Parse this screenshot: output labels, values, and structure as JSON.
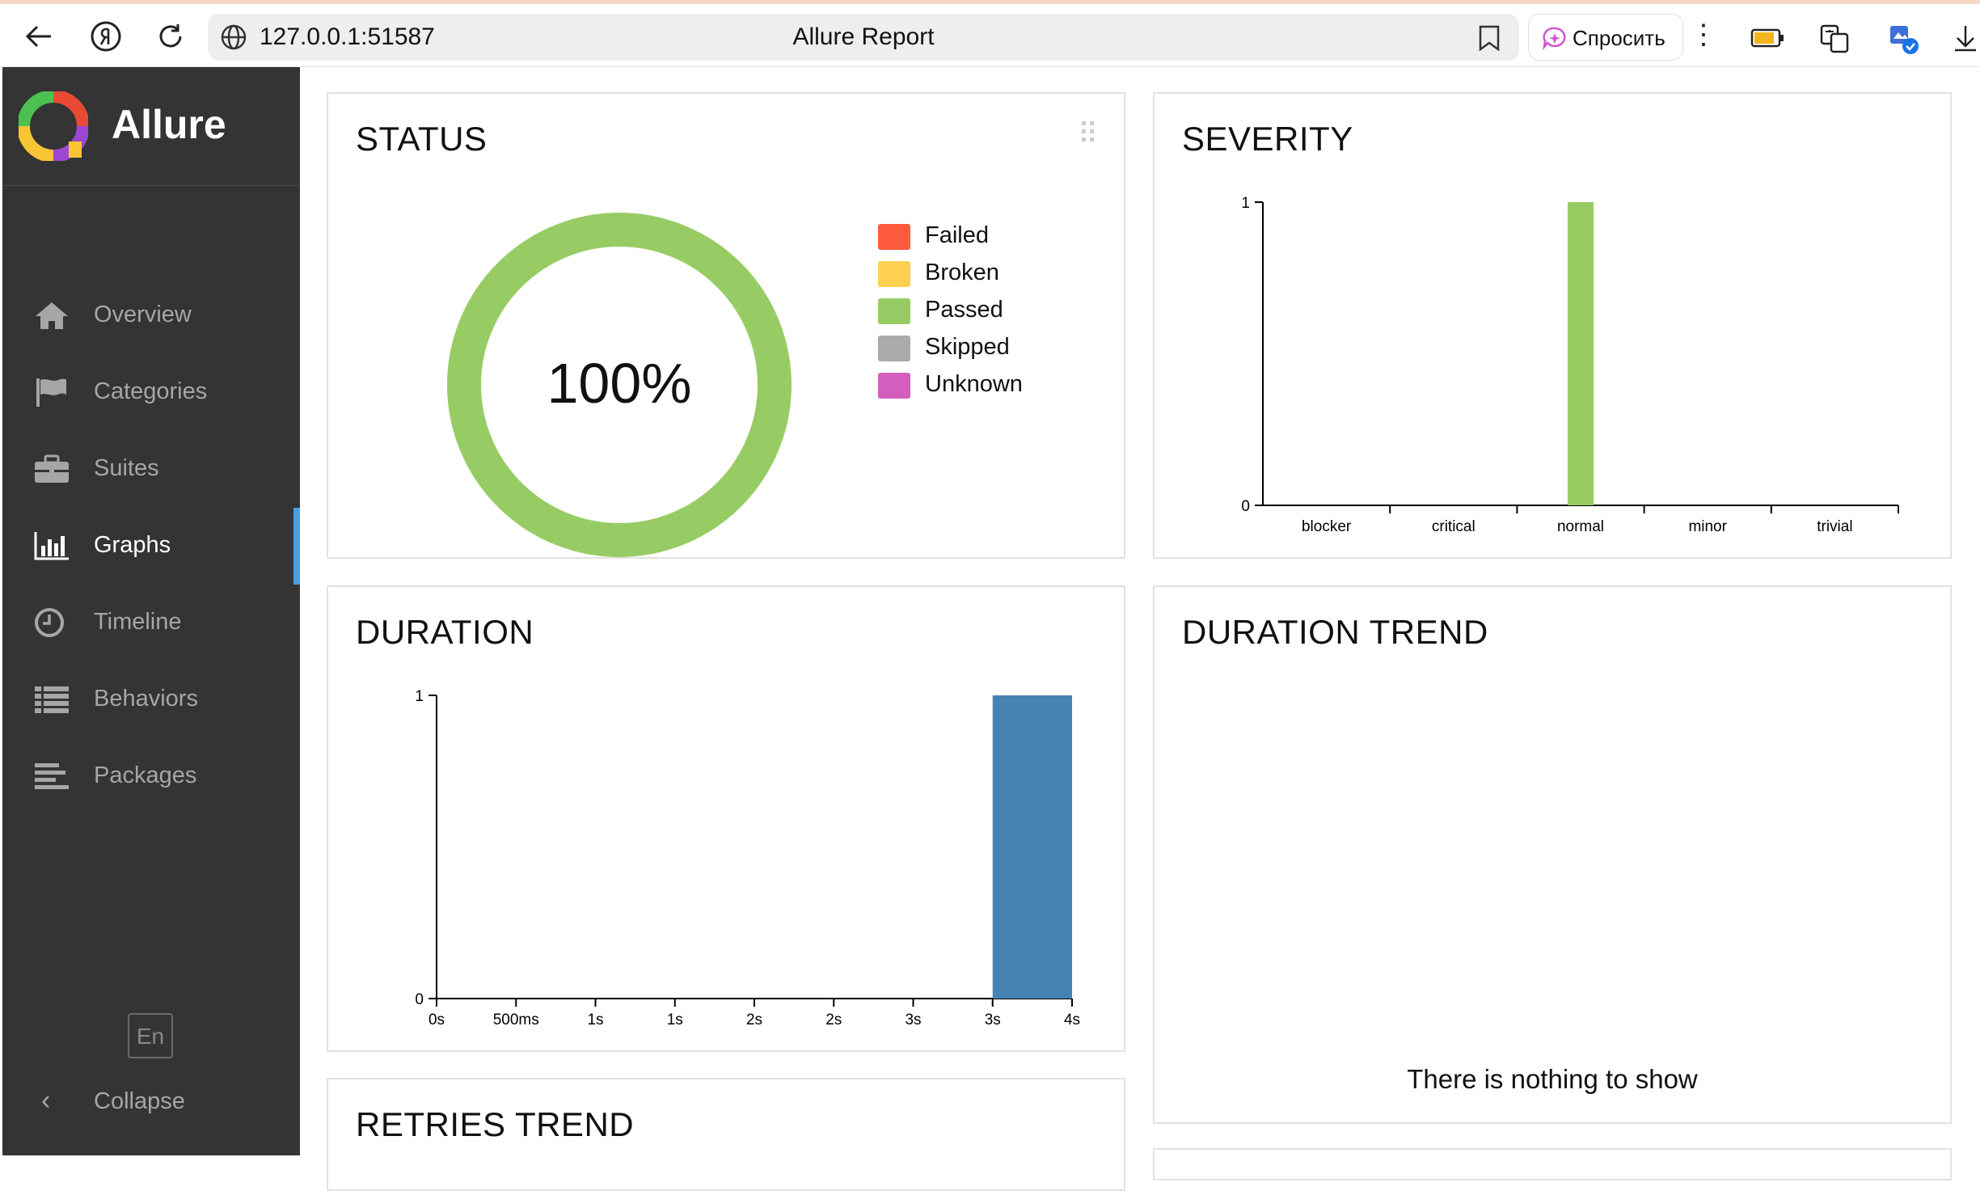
{
  "browser": {
    "url": "127.0.0.1:51587",
    "page_title": "Allure Report",
    "ask_label": "Спросить"
  },
  "sidebar": {
    "brand": "Allure",
    "items": [
      {
        "label": "Overview",
        "icon": "home-icon",
        "active": false
      },
      {
        "label": "Categories",
        "icon": "flag-icon",
        "active": false
      },
      {
        "label": "Suites",
        "icon": "briefcase-icon",
        "active": false
      },
      {
        "label": "Graphs",
        "icon": "bar-chart-icon",
        "active": true
      },
      {
        "label": "Timeline",
        "icon": "clock-icon",
        "active": false
      },
      {
        "label": "Behaviors",
        "icon": "list-icon",
        "active": false
      },
      {
        "label": "Packages",
        "icon": "align-left-icon",
        "active": false
      }
    ],
    "language": "En",
    "collapse_label": "Collapse"
  },
  "widgets": {
    "status": {
      "title": "STATUS",
      "percent_label": "100%",
      "legend": [
        {
          "label": "Failed",
          "color": "#fd5a3e"
        },
        {
          "label": "Broken",
          "color": "#ffd050"
        },
        {
          "label": "Passed",
          "color": "#97cc64"
        },
        {
          "label": "Skipped",
          "color": "#aaaaaa"
        },
        {
          "label": "Unknown",
          "color": "#d35ebe"
        }
      ]
    },
    "severity": {
      "title": "SEVERITY"
    },
    "duration": {
      "title": "DURATION"
    },
    "duration_trend": {
      "title": "DURATION TREND",
      "empty_message": "There is nothing to show"
    },
    "retries_trend": {
      "title": "RETRIES TREND"
    }
  },
  "chart_data": [
    {
      "type": "pie",
      "title": "STATUS",
      "categories": [
        "Failed",
        "Broken",
        "Passed",
        "Skipped",
        "Unknown"
      ],
      "values": [
        0,
        0,
        1,
        0,
        0
      ],
      "colors": [
        "#fd5a3e",
        "#ffd050",
        "#97cc64",
        "#aaaaaa",
        "#d35ebe"
      ],
      "center_label": "100%"
    },
    {
      "type": "bar",
      "title": "SEVERITY",
      "categories": [
        "blocker",
        "critical",
        "normal",
        "minor",
        "trivial"
      ],
      "values": [
        0,
        0,
        1,
        0,
        0
      ],
      "ylim": [
        0,
        1
      ],
      "yticks": [
        "0",
        "1"
      ],
      "color": "#97cc64"
    },
    {
      "type": "bar",
      "title": "DURATION",
      "x_tick_labels": [
        "0s",
        "500ms",
        "1s",
        "1s",
        "2s",
        "2s",
        "3s",
        "3s",
        "4s"
      ],
      "bins": [
        {
          "start_index": 7,
          "end_index": 8,
          "count": 1
        }
      ],
      "ylim": [
        0,
        1
      ],
      "yticks": [
        "0",
        "1"
      ],
      "color": "#4682b4"
    }
  ]
}
